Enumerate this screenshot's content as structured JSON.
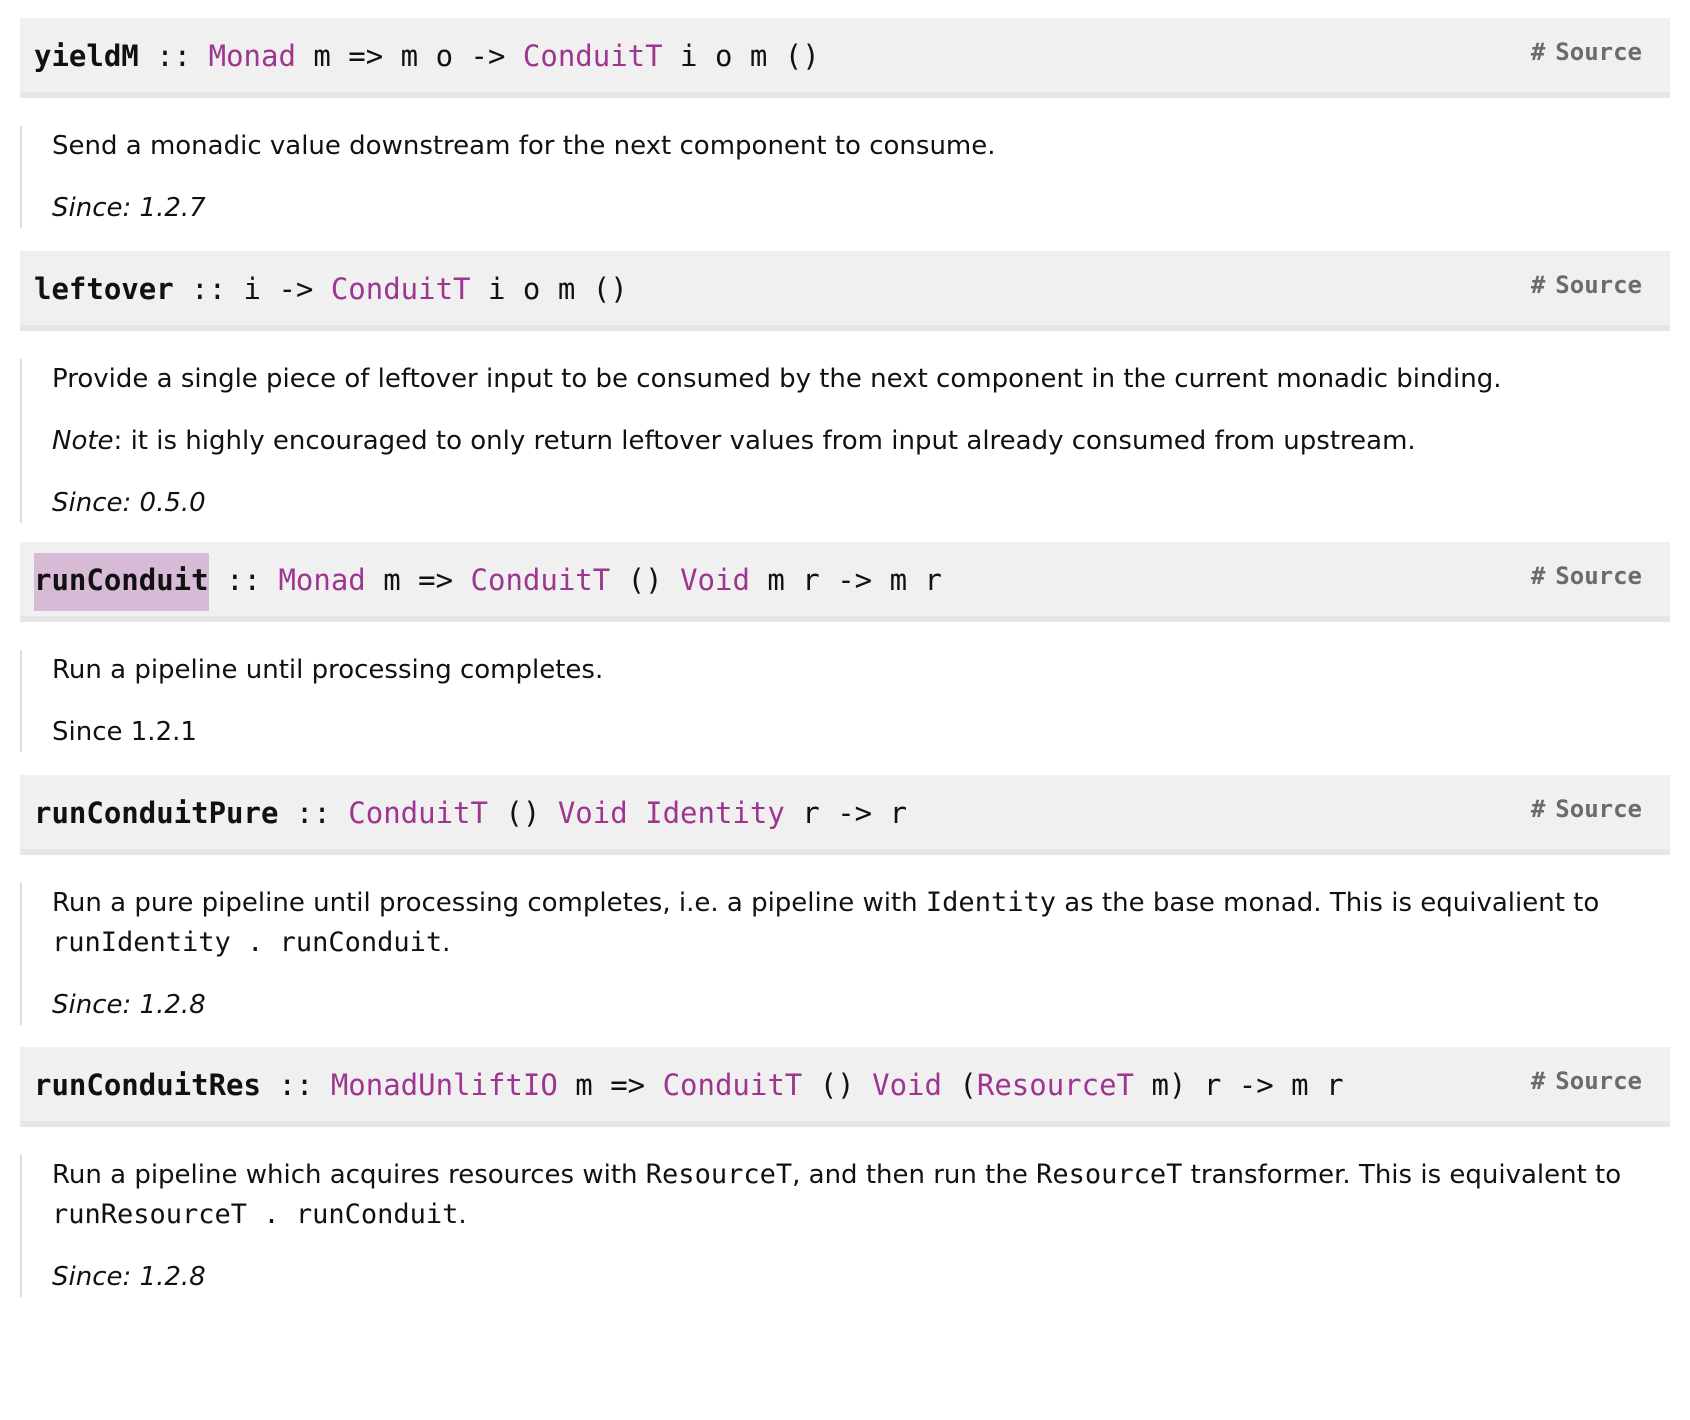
{
  "source_label": "Source",
  "hash_label": "#",
  "sep": " :: ",
  "declarations": [
    {
      "name": "yieldM",
      "signature": [
        {
          "t": "Monad",
          "type": true
        },
        {
          "t": " m => m o -> ",
          "type": false
        },
        {
          "t": "ConduitT",
          "type": true
        },
        {
          "t": " i o m ()",
          "type": false
        }
      ],
      "doc": [
        [
          {
            "t": "Send a monadic value downstream for the next component to consume."
          }
        ],
        [
          {
            "t": "Since: 1.2.7",
            "italic": true
          }
        ]
      ]
    },
    {
      "name": "leftover",
      "signature": [
        {
          "t": "i -> ",
          "type": false
        },
        {
          "t": "ConduitT",
          "type": true
        },
        {
          "t": " i o m ()",
          "type": false
        }
      ],
      "doc": [
        [
          {
            "t": "Provide a single piece of leftover input to be consumed by the next component in the current monadic binding."
          }
        ],
        [
          {
            "t": "Note",
            "italic": true
          },
          {
            "t": ": it is highly encouraged to only return leftover values from input already consumed from upstream."
          }
        ],
        [
          {
            "t": "Since: 0.5.0",
            "italic": true
          }
        ]
      ]
    },
    {
      "name": "runConduit",
      "highlighted": true,
      "signature": [
        {
          "t": "Monad",
          "type": true
        },
        {
          "t": " m => ",
          "type": false
        },
        {
          "t": "ConduitT",
          "type": true
        },
        {
          "t": " () ",
          "type": false
        },
        {
          "t": "Void",
          "type": true
        },
        {
          "t": " m r -> m r",
          "type": false
        }
      ],
      "doc": [
        [
          {
            "t": "Run a pipeline until processing completes."
          }
        ],
        [
          {
            "t": "Since 1.2.1"
          }
        ]
      ]
    },
    {
      "name": "runConduitPure",
      "signature": [
        {
          "t": "ConduitT",
          "type": true
        },
        {
          "t": " () ",
          "type": false
        },
        {
          "t": "Void",
          "type": true
        },
        {
          "t": " ",
          "type": false
        },
        {
          "t": "Identity",
          "type": true
        },
        {
          "t": " r -> r",
          "type": false
        }
      ],
      "doc": [
        [
          {
            "t": "Run a pure pipeline until processing completes, i.e. a pipeline with "
          },
          {
            "t": "Identity",
            "code": true
          },
          {
            "t": " as the base monad. This is equivalient to "
          },
          {
            "t": "runIdentity . runConduit",
            "code": true
          },
          {
            "t": "."
          }
        ],
        [
          {
            "t": "Since: 1.2.8",
            "italic": true
          }
        ]
      ]
    },
    {
      "name": "runConduitRes",
      "signature": [
        {
          "t": "MonadUnliftIO",
          "type": true
        },
        {
          "t": " m => ",
          "type": false
        },
        {
          "t": "ConduitT",
          "type": true
        },
        {
          "t": " () ",
          "type": false
        },
        {
          "t": "Void",
          "type": true
        },
        {
          "t": " (",
          "type": false
        },
        {
          "t": "ResourceT",
          "type": true
        },
        {
          "t": " m) r -> m r",
          "type": false
        }
      ],
      "doc": [
        [
          {
            "t": "Run a pipeline which acquires resources with "
          },
          {
            "t": "ResourceT",
            "code": true
          },
          {
            "t": ", and then run the "
          },
          {
            "t": "ResourceT",
            "code": true
          },
          {
            "t": " transformer. This is equivalent to "
          },
          {
            "t": "runResourceT . runConduit",
            "code": true
          },
          {
            "t": "."
          }
        ],
        [
          {
            "t": "Since: 1.2.8",
            "italic": true
          }
        ]
      ]
    }
  ]
}
